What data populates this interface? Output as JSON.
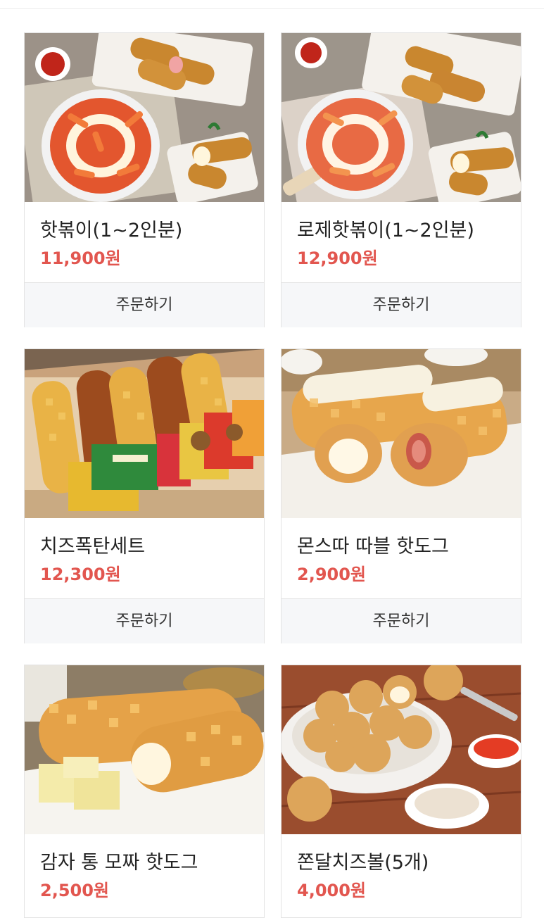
{
  "products": [
    {
      "name": "핫볶이(1~2인분)",
      "price": "11,900원",
      "order_label": "주문하기",
      "image": "tteokbokki-with-corndogs"
    },
    {
      "name": "로제핫볶이(1~2인분)",
      "price": "12,900원",
      "order_label": "주문하기",
      "image": "rose-tteokbokki-with-corndogs"
    },
    {
      "name": "치즈폭탄세트",
      "price": "12,300원",
      "order_label": "주문하기",
      "image": "corndog-box-set"
    },
    {
      "name": "몬스따 따블 핫도그",
      "price": "2,900원",
      "order_label": "주문하기",
      "image": "cheese-potato-hotdogs"
    },
    {
      "name": "감자 통 모짜 핫도그",
      "price": "2,500원",
      "order_label": "",
      "image": "potato-mozzarella-hotdog"
    },
    {
      "name": "쫀달치즈볼(5개)",
      "price": "4,000원",
      "order_label": "",
      "image": "cheese-balls"
    }
  ],
  "colors": {
    "price": "#e2564f",
    "border": "#e3e3e3",
    "button_bg": "#f6f7f9"
  }
}
